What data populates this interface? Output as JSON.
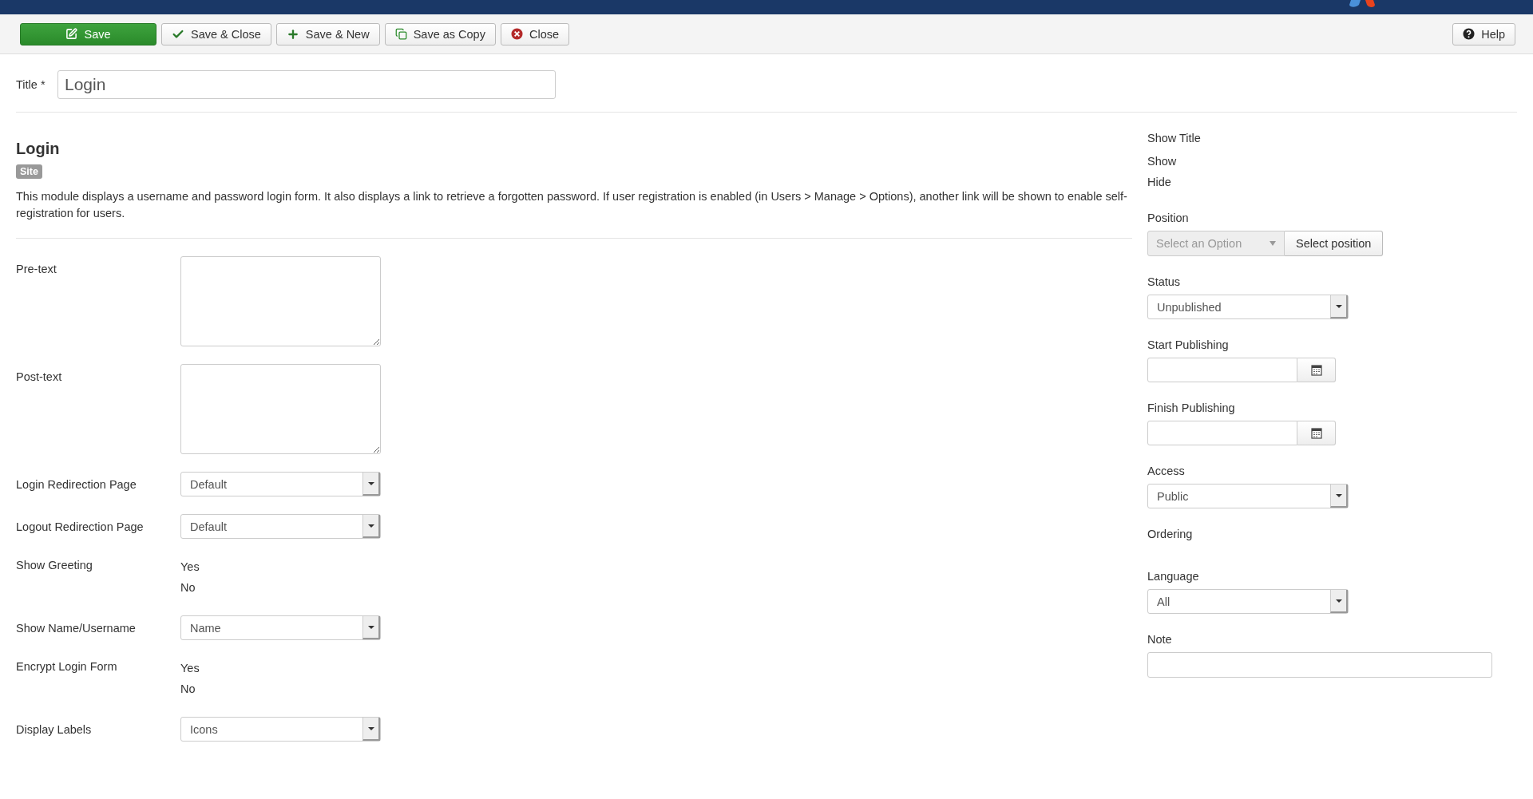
{
  "toolbar": {
    "buttons": [
      {
        "label": "Save",
        "kind": "primary"
      },
      {
        "label": "Save & Close",
        "kind": "default"
      },
      {
        "label": "Save & New",
        "kind": "default"
      },
      {
        "label": "Save as Copy",
        "kind": "default"
      },
      {
        "label": "Close",
        "kind": "default"
      }
    ],
    "help": {
      "label": "Help"
    }
  },
  "title_field": {
    "label": "Title *",
    "value": "Login"
  },
  "module": {
    "heading": "Login",
    "badge": "Site",
    "description": "This module displays a username and password login form. It also displays a link to retrieve a forgotten password. If user registration is enabled (in Users > Manage > Options), another link will be shown to enable self-registration for users."
  },
  "params": [
    {
      "label": "Pre-text",
      "kind": "textarea"
    },
    {
      "label": "Post-text",
      "kind": "textarea"
    },
    {
      "label": "Login Redirection Page",
      "kind": "select",
      "value": "Default"
    },
    {
      "label": "Logout Redirection Page",
      "kind": "select",
      "value": "Default"
    },
    {
      "label": "Show Greeting",
      "kind": "radio",
      "options": [
        "Yes",
        "No"
      ]
    },
    {
      "label": "Show Name/Username",
      "kind": "select",
      "value": "Name"
    },
    {
      "label": "Encrypt Login Form",
      "kind": "radio",
      "options": [
        "Yes",
        "No"
      ]
    },
    {
      "label": "Display Labels",
      "kind": "select",
      "value": "Icons"
    }
  ],
  "sidebar": [
    {
      "label": "Show Title",
      "kind": "radio",
      "options": [
        "Show",
        "Hide"
      ]
    },
    {
      "label": "Position",
      "kind": "position",
      "placeholder": "Select an Option",
      "button": "Select position"
    },
    {
      "label": "Status",
      "kind": "select",
      "value": "Unpublished"
    },
    {
      "label": "Start Publishing",
      "kind": "date"
    },
    {
      "label": "Finish Publishing",
      "kind": "date"
    },
    {
      "label": "Access",
      "kind": "select",
      "value": "Public"
    },
    {
      "label": "Ordering",
      "kind": "empty"
    },
    {
      "label": "Language",
      "kind": "select",
      "value": "All"
    },
    {
      "label": "Note",
      "kind": "text"
    }
  ]
}
